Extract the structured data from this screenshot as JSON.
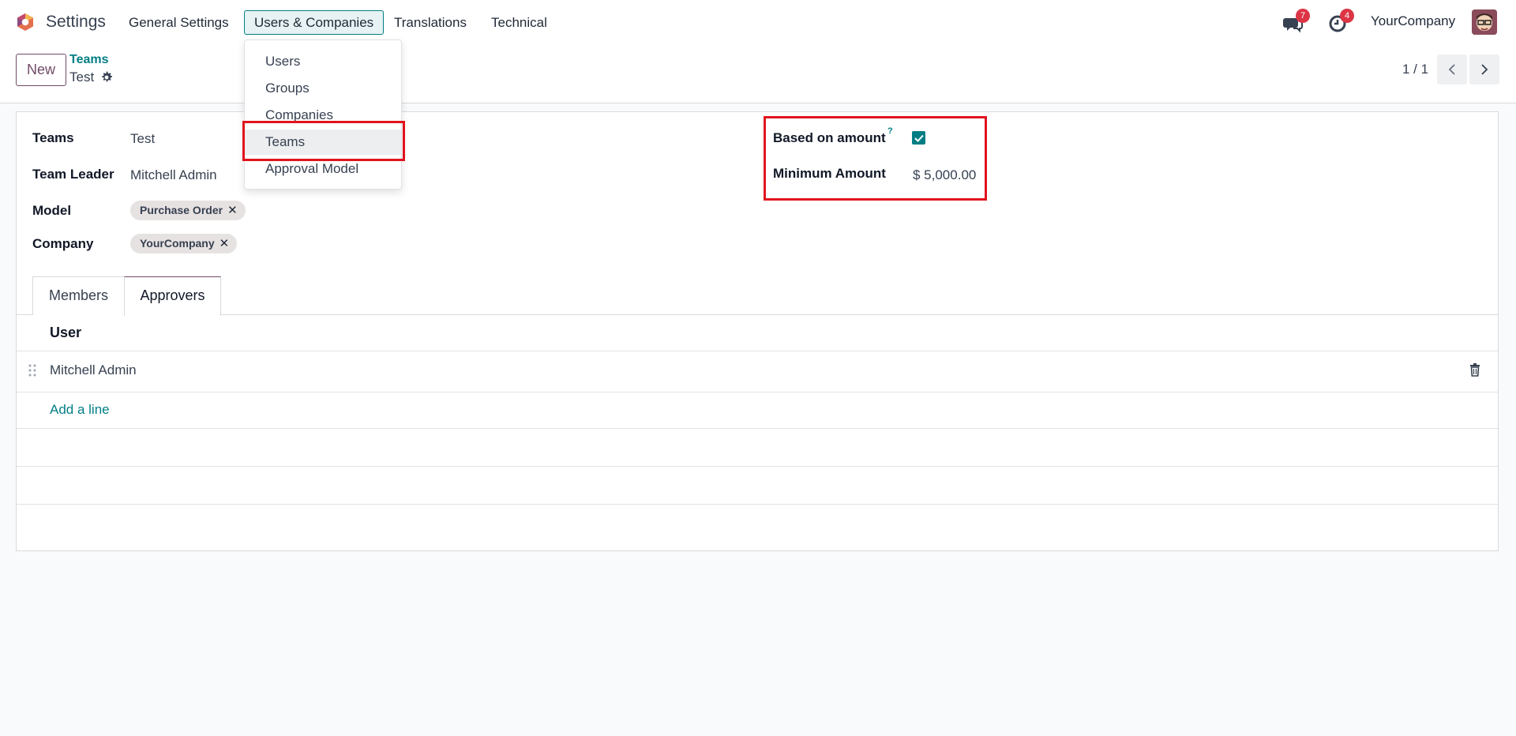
{
  "navbar": {
    "app_name": "Settings",
    "menu": [
      "General Settings",
      "Users & Companies",
      "Translations",
      "Technical"
    ],
    "active_menu": "Users & Companies",
    "messages_count": "7",
    "activities_count": "4",
    "company": "YourCompany",
    "icons": {
      "logo": "odoo-logo-icon",
      "messages": "chat-icon",
      "activities": "clock-icon"
    }
  },
  "control_panel": {
    "new_label": "New",
    "breadcrumb_parent": "Teams",
    "breadcrumb_current": "Test",
    "pager": "1 / 1"
  },
  "dropdown": {
    "items": [
      "Users",
      "Groups",
      "Companies",
      "Teams",
      "Approval Model"
    ],
    "hovered": "Teams"
  },
  "form": {
    "teams_label": "Teams",
    "teams_value": "Test",
    "leader_label": "Team Leader",
    "leader_value": "Mitchell Admin",
    "model_label": "Model",
    "model_tag": "Purchase Order",
    "company_label": "Company",
    "company_tag": "YourCompany",
    "based_label": "Based on amount",
    "based_help": "?",
    "based_checked": true,
    "min_label": "Minimum Amount",
    "min_value": "$ 5,000.00"
  },
  "tabs": [
    "Members",
    "Approvers"
  ],
  "active_tab": "Approvers",
  "approvers": {
    "column": "User",
    "rows": [
      "Mitchell Admin"
    ],
    "add_line": "Add a line"
  },
  "colors": {
    "accent": "#017e84",
    "brand": "#714b67",
    "highlight": "#e0141e"
  }
}
